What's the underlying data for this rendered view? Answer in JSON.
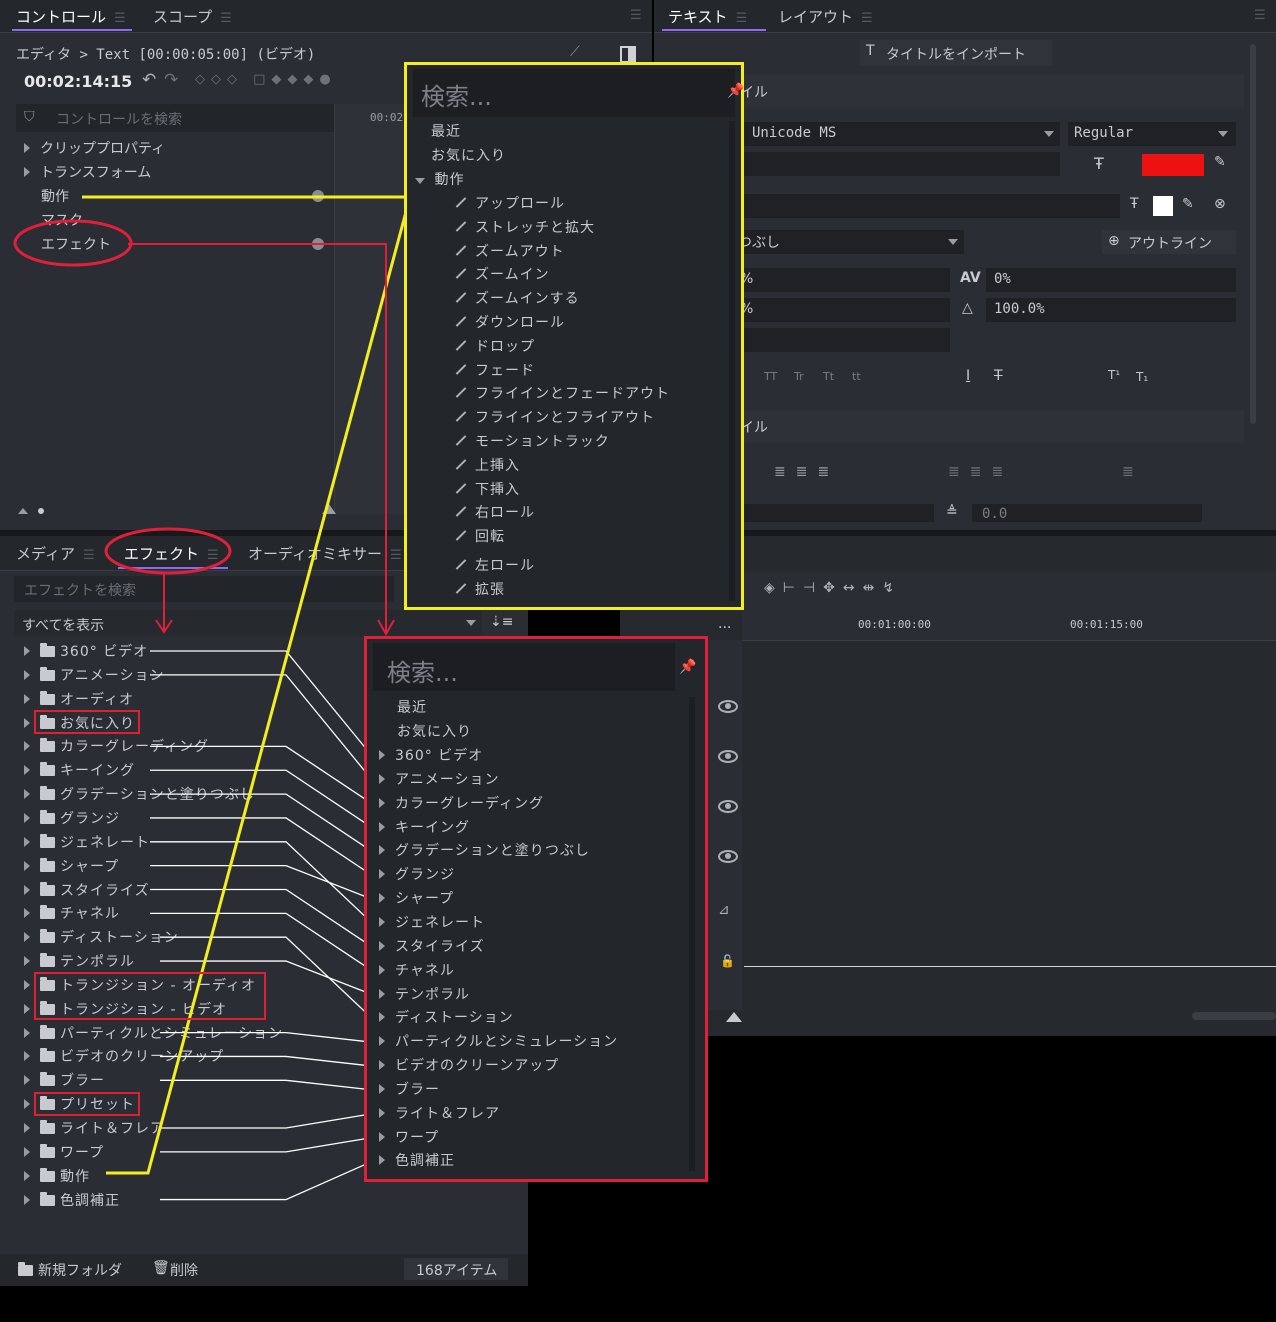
{
  "control_panel": {
    "tabs": [
      "コントロール",
      "スコープ"
    ],
    "breadcrumb": "エディタ > Text [00:00:05:00] (ビデオ)",
    "timecode": "00:02:14:15",
    "search_placeholder": "コントロールを検索",
    "ruler_label": "00:02",
    "tree": [
      "クリッププロパティ",
      "トランスフォーム",
      "動作",
      "マスク",
      "エフェクト"
    ]
  },
  "text_panel": {
    "tabs": [
      "テキスト",
      "レイアウト"
    ],
    "import_button": "タイトルをインポート",
    "section_style": "イル",
    "font_name": "Unicode MS",
    "font_style": "Regular",
    "fill_label": "つぶし",
    "outline_button": "アウトライン",
    "tracking_value": "0%",
    "scale_value": "100.0%",
    "left_pct_1": "%",
    "left_pct_2": "%",
    "case_buttons": [
      "TT",
      "Tr",
      "Tt",
      "tt"
    ],
    "section_para": "イル",
    "baseline_value": "0.0",
    "text_color": "#ee1111",
    "stroke_color": "#ffffff"
  },
  "effects_panel": {
    "tabs": [
      "メディア",
      "エフェクト",
      "オーディオミキサー"
    ],
    "search_placeholder": "エフェクトを検索",
    "filter_label": "すべてを表示",
    "folders": [
      "360° ビデオ",
      "アニメーション",
      "オーディオ",
      "お気に入り",
      "カラーグレーディング",
      "キーイング",
      "グラデーションと塗りつぶし",
      "グランジ",
      "ジェネレート",
      "シャープ",
      "スタイライズ",
      "チャネル",
      "ディストーション",
      "テンポラル",
      "トランジション - オーディオ",
      "トランジション - ビデオ",
      "パーティクルとシミュレーション",
      "ビデオのクリーンアップ",
      "ブラー",
      "プリセット",
      "ライト＆フレア",
      "ワープ",
      "動作",
      "色調補正"
    ],
    "new_folder": "新規フォルダ",
    "delete": "削除",
    "count": "168アイテム"
  },
  "timeline": {
    "ruler": [
      "00:01:00:00",
      "00:01:15:00"
    ],
    "more": "..."
  },
  "popup_motion": {
    "search_placeholder": "検索...",
    "top_items": [
      "最近",
      "お気に入り"
    ],
    "category": "動作",
    "items": [
      "アップロール",
      "ストレッチと拡大",
      "ズームアウト",
      "ズームイン",
      "ズームインする",
      "ダウンロール",
      "ドロップ",
      "フェード",
      "フライインとフェードアウト",
      "フライインとフライアウト",
      "モーショントラック",
      "上挿入",
      "下挿入",
      "右ロール",
      "回転",
      "左ロール",
      "拡張"
    ]
  },
  "popup_effects": {
    "search_placeholder": "検索...",
    "top_items": [
      "最近",
      "お気に入り"
    ],
    "items": [
      "360° ビデオ",
      "アニメーション",
      "カラーグレーディング",
      "キーイング",
      "グラデーションと塗りつぶし",
      "グランジ",
      "シャープ",
      "ジェネレート",
      "スタイライズ",
      "チャネル",
      "テンポラル",
      "ディストーション",
      "パーティクルとシミュレーション",
      "ビデオのクリーンアップ",
      "ブラー",
      "ライト＆フレア",
      "ワープ",
      "色調補正"
    ]
  },
  "colors": {
    "accent": "#8b6cf0",
    "annotation_yellow": "#f2ef1c",
    "annotation_red": "#e0203a"
  }
}
